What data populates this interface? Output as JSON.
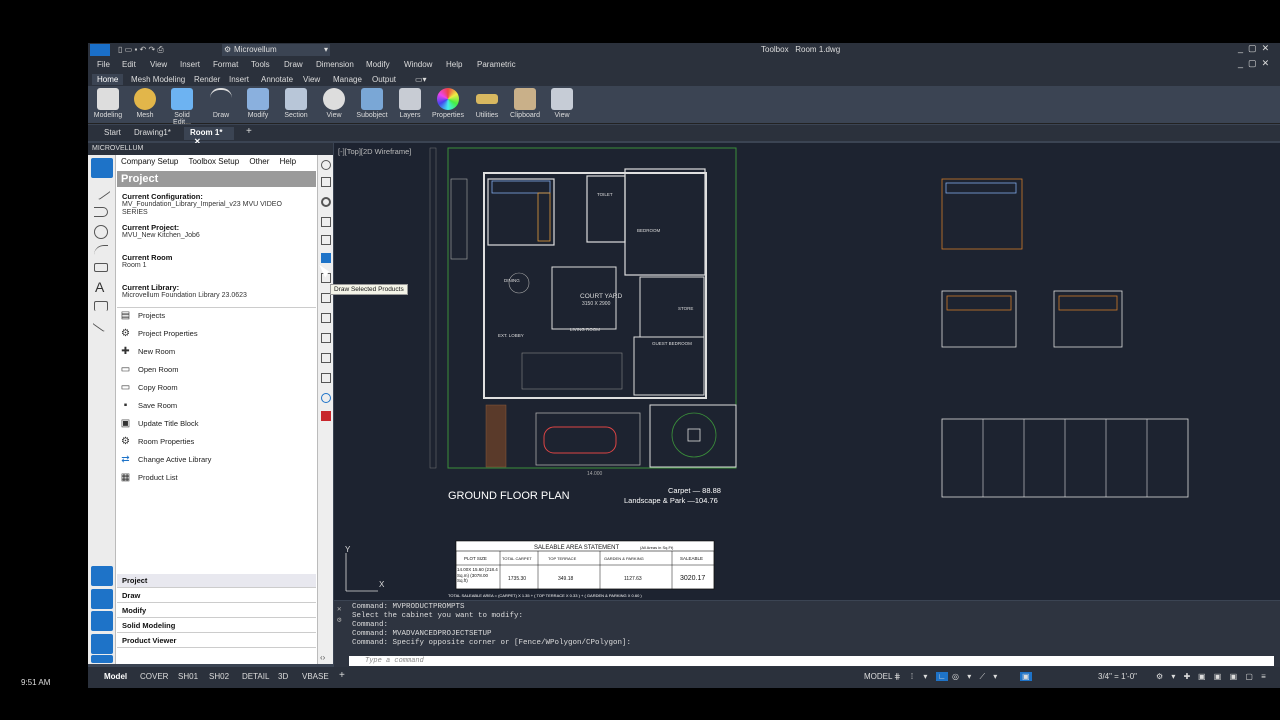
{
  "titlebar": {
    "app_title": "Toolbox",
    "doc_title": "Room 1.dwg",
    "workspace": "Microvellum"
  },
  "menubar": [
    "File",
    "Edit",
    "View",
    "Insert",
    "Format",
    "Tools",
    "Draw",
    "Dimension",
    "Modify",
    "Window",
    "Help",
    "Parametric"
  ],
  "ribbon_tabs": [
    "Home",
    "Mesh Modeling",
    "Render",
    "Insert",
    "Annotate",
    "View",
    "Manage",
    "Output"
  ],
  "ribbon_buttons": [
    "Modeling",
    "Mesh",
    "Solid Edit...",
    "Draw",
    "Modify",
    "Section",
    "View",
    "Subobject",
    "Layers",
    "Properties",
    "Utilities",
    "Clipboard",
    "View"
  ],
  "doc_tabs": [
    "Start",
    "Drawing1*",
    "Room 1*"
  ],
  "panel": {
    "header": "MICROVELLUM",
    "menu": [
      "Company Setup",
      "Toolbox Setup",
      "Other",
      "Help"
    ],
    "title": "Project",
    "config_label": "Current Configuration:",
    "config_value": "MV_Foundation_Library_Imperial_v23 MVU VIDEO SERIES",
    "project_label": "Current Project:",
    "project_value": "MVU_New Kitchen_Job6",
    "room_label": "Current Room",
    "room_value": "Room 1",
    "library_label": "Current Library:",
    "library_value": "Microvellum Foundation Library 23.0623",
    "items": [
      "Projects",
      "Project Properties",
      "New Room",
      "Open Room",
      "Copy Room",
      "Save Room",
      "Update Title Block",
      "Room Properties",
      "Change Active Library",
      "Product List"
    ],
    "footer_tabs": [
      "Project",
      "Draw",
      "Modify",
      "Solid Modeling",
      "Product Viewer"
    ]
  },
  "tooltip": "Draw Selected Products",
  "viewport_label": "[-][Top][2D Wireframe]",
  "drawing": {
    "plan_title": "GROUND FLOOR PLAN",
    "carpet": "Carpet  —  88.88",
    "landscape": "Landscape & Park  —104.76",
    "courtyard": "COURT YARD",
    "courtyard_dim": "3150 X 2900",
    "toilet": "TOILET",
    "bedroom": "BEDROOM",
    "living": "LIVING ROOM",
    "dining": "DINING",
    "store": "STORE",
    "guest": "GUEST BEDROOM",
    "ext_lobby": "EXT. LOBBY",
    "dim_width": "14.000",
    "table_title": "SALEABLE AREA STATEMENT",
    "table_subtitle": "(All Areas in Sq.Ft)",
    "table_headers": [
      "PLOT SIZE",
      "TOTAL CARPET",
      "TOP TERRACE",
      "GARDEN & PARKING",
      "SALEABLE"
    ],
    "table_values": [
      "14.00X 15.60 (218.4 Sq.m) (3078.00 Sq.ft)",
      "1735.30",
      "349.18",
      "1127.63",
      "3020.17"
    ],
    "table_footer": "TOTAL SALEABLE AREA = (CARPET) X 1.35 + ( TOP TERRACE X 0.33 ) + ( GARDEN & PARKING X 0.60 )"
  },
  "command_lines": [
    "Command: MVPRODUCTPROMPTS",
    "Select the cabinet you want to modify:",
    "Command:",
    "Command: MVADVANCEDPROJECTSETUP",
    "Command: Specify opposite corner or [Fence/WPolygon/CPolygon]:"
  ],
  "command_placeholder": "Type a command",
  "status_tabs": [
    "Model",
    "COVER",
    "SH01",
    "SH02",
    "DETAIL",
    "3D",
    "VBASE"
  ],
  "status_right": {
    "model": "MODEL",
    "scale": "3/4\" = 1'-0\""
  },
  "clock": "9:51 AM"
}
